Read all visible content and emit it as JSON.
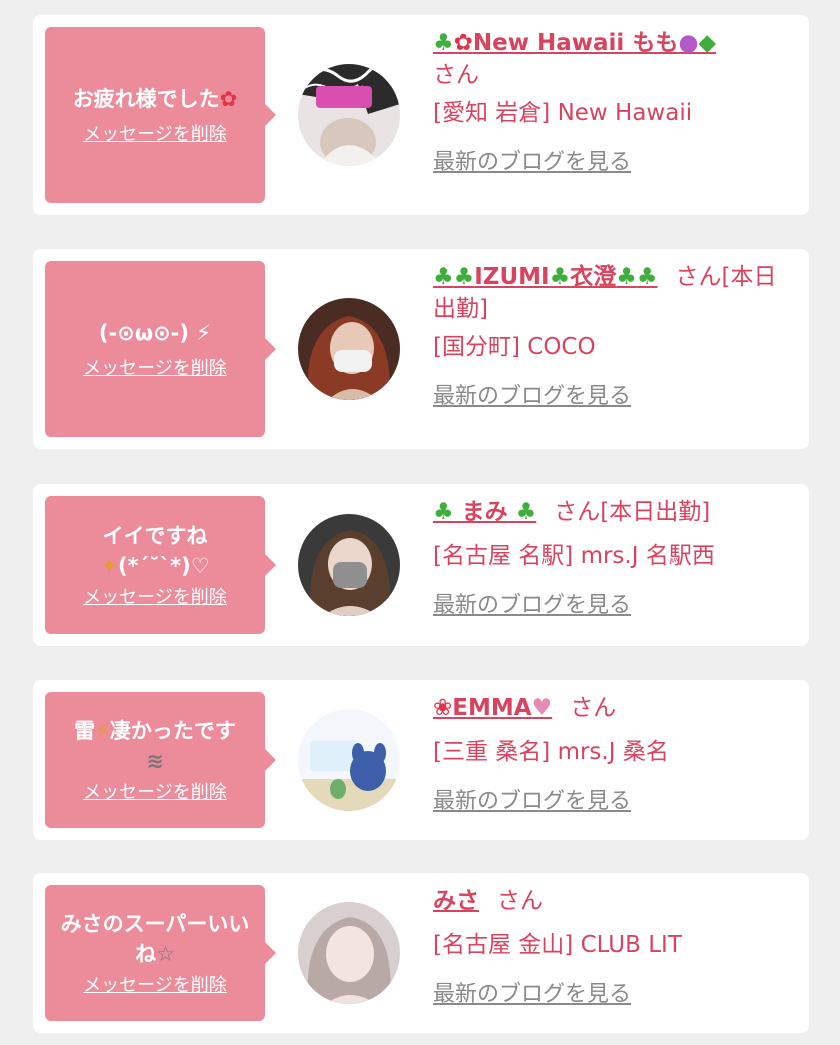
{
  "colors": {
    "background": "#efefef",
    "card": "#ffffff",
    "bubble": "#ec8c9b",
    "accent_text": "#d8445f",
    "link_gray": "#8a8a8a"
  },
  "delete_label": "メッセージを削除",
  "blog_label": "最新のブログを見る",
  "items": [
    {
      "message": "お疲れ様でした",
      "message_icon": "flower-icon",
      "name_prefix_icons": [
        "palm-tree-icon",
        "hibiscus-icon"
      ],
      "name": "New Hawaii もも",
      "name_suffix_icons": [
        "peach-icon",
        "turtle-icon"
      ],
      "san": "さん",
      "shop": "[愛知 岩倉] New Hawaii"
    },
    {
      "message": "(-⊙ω⊙-)",
      "message_icon": "sparkle-icon",
      "name_prefix_icons": [
        "cactus-icon",
        "cactus-icon"
      ],
      "name": "IZUMI",
      "name_mid_icon": "cactus-icon",
      "name_tail": "衣澄",
      "name_suffix_icons": [
        "cactus-icon",
        "cactus-icon"
      ],
      "san": "さん[本日出勤]",
      "shop": "[国分町] COCO"
    },
    {
      "message": "イイですね",
      "message_line2": "(*´˘`*)♡",
      "message_icon": "sparkle-icon",
      "name_prefix_icons": [
        "clover-icon"
      ],
      "name": "まみ",
      "name_suffix_icons": [
        "clover-icon"
      ],
      "san": "さん[本日出勤]",
      "shop": "[名古屋 名駅] mrs.J 名駅西"
    },
    {
      "message": "雷",
      "message_icon": "lightning-icon",
      "message_after": "凄かったです",
      "message_tail_icon": "dash-icon",
      "name_prefix_icons": [
        "rose-icon"
      ],
      "name": "EMMA",
      "name_suffix_icons": [
        "pink-heart-icon"
      ],
      "san": "さん",
      "shop": "[三重 桑名] mrs.J 桑名"
    },
    {
      "message": "みさのスーパーいいね",
      "message_icon": "star-icon",
      "name_prefix_icons": [],
      "name": "みさ",
      "name_suffix_icons": [],
      "san": "さん",
      "shop": "[名古屋 金山] CLUB LIT"
    }
  ]
}
